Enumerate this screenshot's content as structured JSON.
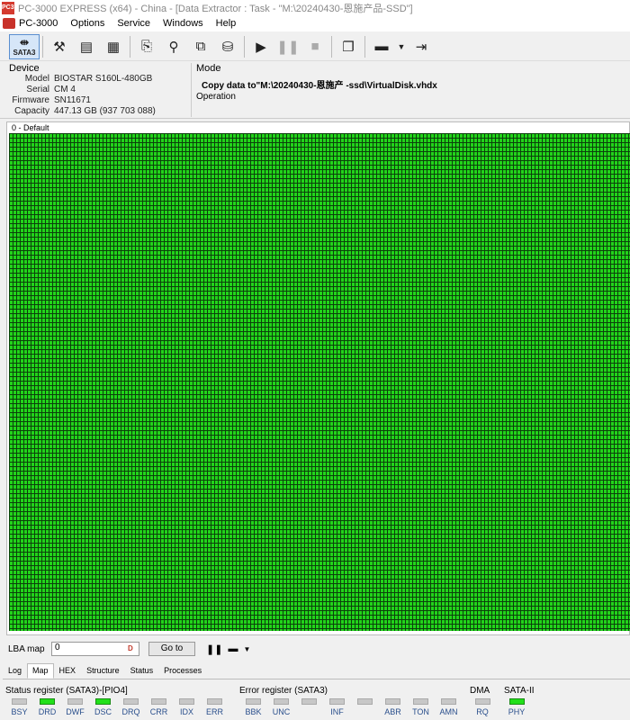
{
  "window": {
    "title": "PC-3000 EXPRESS (x64) - China - [Data Extractor : Task - \"M:\\20240430-恩施产品-SSD\"]",
    "icon_label": "PC3K"
  },
  "menu": {
    "items": [
      "PC-3000",
      "Options",
      "Service",
      "Windows",
      "Help"
    ]
  },
  "toolbar": {
    "sata_label": "SATA3",
    "buttons": [
      "tools-icon",
      "read-icon",
      "data-icon",
      "scan-icon",
      "find-icon",
      "copy-icon",
      "disk-icon",
      "play-icon",
      "pause-icon",
      "stop-icon",
      "windows-icon",
      "map-icon",
      "exit-icon"
    ]
  },
  "device": {
    "title": "Device",
    "model_key": "Model",
    "model": "BIOSTAR S160L-480GB",
    "serial_key": "Serial",
    "serial": "CM              4",
    "firmware_key": "Firmware",
    "firmware": "SN11671",
    "capacity_key": "Capacity",
    "capacity": "447.13 GB (937 703 088)"
  },
  "mode": {
    "title": "Mode",
    "text": "Copy data to\"M:\\20240430-恩施产    -ssd\\VirtualDisk.vhdx",
    "operation_title": "Operation"
  },
  "map": {
    "label": "0 - Default",
    "block_color": "#22d41a",
    "state": "all blocks read (green)"
  },
  "lba": {
    "label": "LBA map",
    "value": "0",
    "goto": "Go to"
  },
  "tabs": [
    "Log",
    "Map",
    "HEX",
    "Structure",
    "Status",
    "Processes"
  ],
  "active_tab": "Map",
  "status": {
    "status_title": "Status register (SATA3)-[PIO4]",
    "status_leds": [
      {
        "name": "BSY",
        "on": false
      },
      {
        "name": "DRD",
        "on": true
      },
      {
        "name": "DWF",
        "on": false
      },
      {
        "name": "DSC",
        "on": true
      },
      {
        "name": "DRQ",
        "on": false
      },
      {
        "name": "CRR",
        "on": false
      },
      {
        "name": "IDX",
        "on": false
      },
      {
        "name": "ERR",
        "on": false
      }
    ],
    "error_title": "Error register (SATA3)",
    "error_leds": [
      {
        "name": "BBK",
        "on": false
      },
      {
        "name": "UNC",
        "on": false
      },
      {
        "name": "",
        "on": false
      },
      {
        "name": "INF",
        "on": false
      },
      {
        "name": "",
        "on": false
      },
      {
        "name": "ABR",
        "on": false
      },
      {
        "name": "TON",
        "on": false
      },
      {
        "name": "AMN",
        "on": false
      }
    ],
    "dma_title": "DMA",
    "dma_leds": [
      {
        "name": "RQ",
        "on": false
      }
    ],
    "sata_title": "SATA-II",
    "sata_leds": [
      {
        "name": "PHY",
        "on": true
      }
    ]
  }
}
